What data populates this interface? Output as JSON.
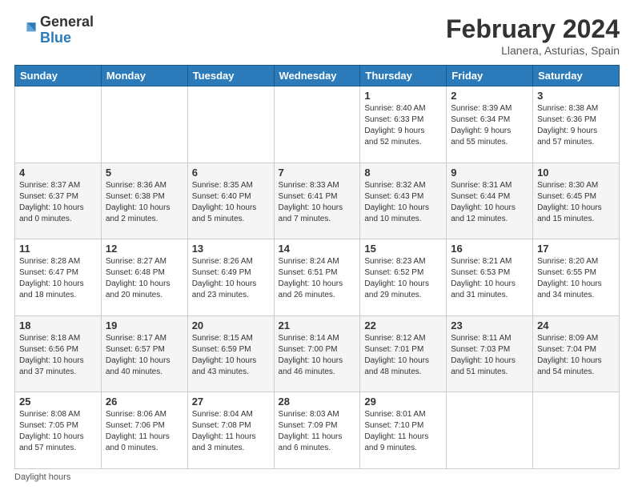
{
  "header": {
    "logo_general": "General",
    "logo_blue": "Blue",
    "month_title": "February 2024",
    "location": "Llanera, Asturias, Spain"
  },
  "calendar": {
    "days_of_week": [
      "Sunday",
      "Monday",
      "Tuesday",
      "Wednesday",
      "Thursday",
      "Friday",
      "Saturday"
    ],
    "weeks": [
      [
        {
          "day": "",
          "info": ""
        },
        {
          "day": "",
          "info": ""
        },
        {
          "day": "",
          "info": ""
        },
        {
          "day": "",
          "info": ""
        },
        {
          "day": "1",
          "info": "Sunrise: 8:40 AM\nSunset: 6:33 PM\nDaylight: 9 hours\nand 52 minutes."
        },
        {
          "day": "2",
          "info": "Sunrise: 8:39 AM\nSunset: 6:34 PM\nDaylight: 9 hours\nand 55 minutes."
        },
        {
          "day": "3",
          "info": "Sunrise: 8:38 AM\nSunset: 6:36 PM\nDaylight: 9 hours\nand 57 minutes."
        }
      ],
      [
        {
          "day": "4",
          "info": "Sunrise: 8:37 AM\nSunset: 6:37 PM\nDaylight: 10 hours\nand 0 minutes."
        },
        {
          "day": "5",
          "info": "Sunrise: 8:36 AM\nSunset: 6:38 PM\nDaylight: 10 hours\nand 2 minutes."
        },
        {
          "day": "6",
          "info": "Sunrise: 8:35 AM\nSunset: 6:40 PM\nDaylight: 10 hours\nand 5 minutes."
        },
        {
          "day": "7",
          "info": "Sunrise: 8:33 AM\nSunset: 6:41 PM\nDaylight: 10 hours\nand 7 minutes."
        },
        {
          "day": "8",
          "info": "Sunrise: 8:32 AM\nSunset: 6:43 PM\nDaylight: 10 hours\nand 10 minutes."
        },
        {
          "day": "9",
          "info": "Sunrise: 8:31 AM\nSunset: 6:44 PM\nDaylight: 10 hours\nand 12 minutes."
        },
        {
          "day": "10",
          "info": "Sunrise: 8:30 AM\nSunset: 6:45 PM\nDaylight: 10 hours\nand 15 minutes."
        }
      ],
      [
        {
          "day": "11",
          "info": "Sunrise: 8:28 AM\nSunset: 6:47 PM\nDaylight: 10 hours\nand 18 minutes."
        },
        {
          "day": "12",
          "info": "Sunrise: 8:27 AM\nSunset: 6:48 PM\nDaylight: 10 hours\nand 20 minutes."
        },
        {
          "day": "13",
          "info": "Sunrise: 8:26 AM\nSunset: 6:49 PM\nDaylight: 10 hours\nand 23 minutes."
        },
        {
          "day": "14",
          "info": "Sunrise: 8:24 AM\nSunset: 6:51 PM\nDaylight: 10 hours\nand 26 minutes."
        },
        {
          "day": "15",
          "info": "Sunrise: 8:23 AM\nSunset: 6:52 PM\nDaylight: 10 hours\nand 29 minutes."
        },
        {
          "day": "16",
          "info": "Sunrise: 8:21 AM\nSunset: 6:53 PM\nDaylight: 10 hours\nand 31 minutes."
        },
        {
          "day": "17",
          "info": "Sunrise: 8:20 AM\nSunset: 6:55 PM\nDaylight: 10 hours\nand 34 minutes."
        }
      ],
      [
        {
          "day": "18",
          "info": "Sunrise: 8:18 AM\nSunset: 6:56 PM\nDaylight: 10 hours\nand 37 minutes."
        },
        {
          "day": "19",
          "info": "Sunrise: 8:17 AM\nSunset: 6:57 PM\nDaylight: 10 hours\nand 40 minutes."
        },
        {
          "day": "20",
          "info": "Sunrise: 8:15 AM\nSunset: 6:59 PM\nDaylight: 10 hours\nand 43 minutes."
        },
        {
          "day": "21",
          "info": "Sunrise: 8:14 AM\nSunset: 7:00 PM\nDaylight: 10 hours\nand 46 minutes."
        },
        {
          "day": "22",
          "info": "Sunrise: 8:12 AM\nSunset: 7:01 PM\nDaylight: 10 hours\nand 48 minutes."
        },
        {
          "day": "23",
          "info": "Sunrise: 8:11 AM\nSunset: 7:03 PM\nDaylight: 10 hours\nand 51 minutes."
        },
        {
          "day": "24",
          "info": "Sunrise: 8:09 AM\nSunset: 7:04 PM\nDaylight: 10 hours\nand 54 minutes."
        }
      ],
      [
        {
          "day": "25",
          "info": "Sunrise: 8:08 AM\nSunset: 7:05 PM\nDaylight: 10 hours\nand 57 minutes."
        },
        {
          "day": "26",
          "info": "Sunrise: 8:06 AM\nSunset: 7:06 PM\nDaylight: 11 hours\nand 0 minutes."
        },
        {
          "day": "27",
          "info": "Sunrise: 8:04 AM\nSunset: 7:08 PM\nDaylight: 11 hours\nand 3 minutes."
        },
        {
          "day": "28",
          "info": "Sunrise: 8:03 AM\nSunset: 7:09 PM\nDaylight: 11 hours\nand 6 minutes."
        },
        {
          "day": "29",
          "info": "Sunrise: 8:01 AM\nSunset: 7:10 PM\nDaylight: 11 hours\nand 9 minutes."
        },
        {
          "day": "",
          "info": ""
        },
        {
          "day": "",
          "info": ""
        }
      ]
    ]
  },
  "footer": {
    "note": "Daylight hours"
  }
}
